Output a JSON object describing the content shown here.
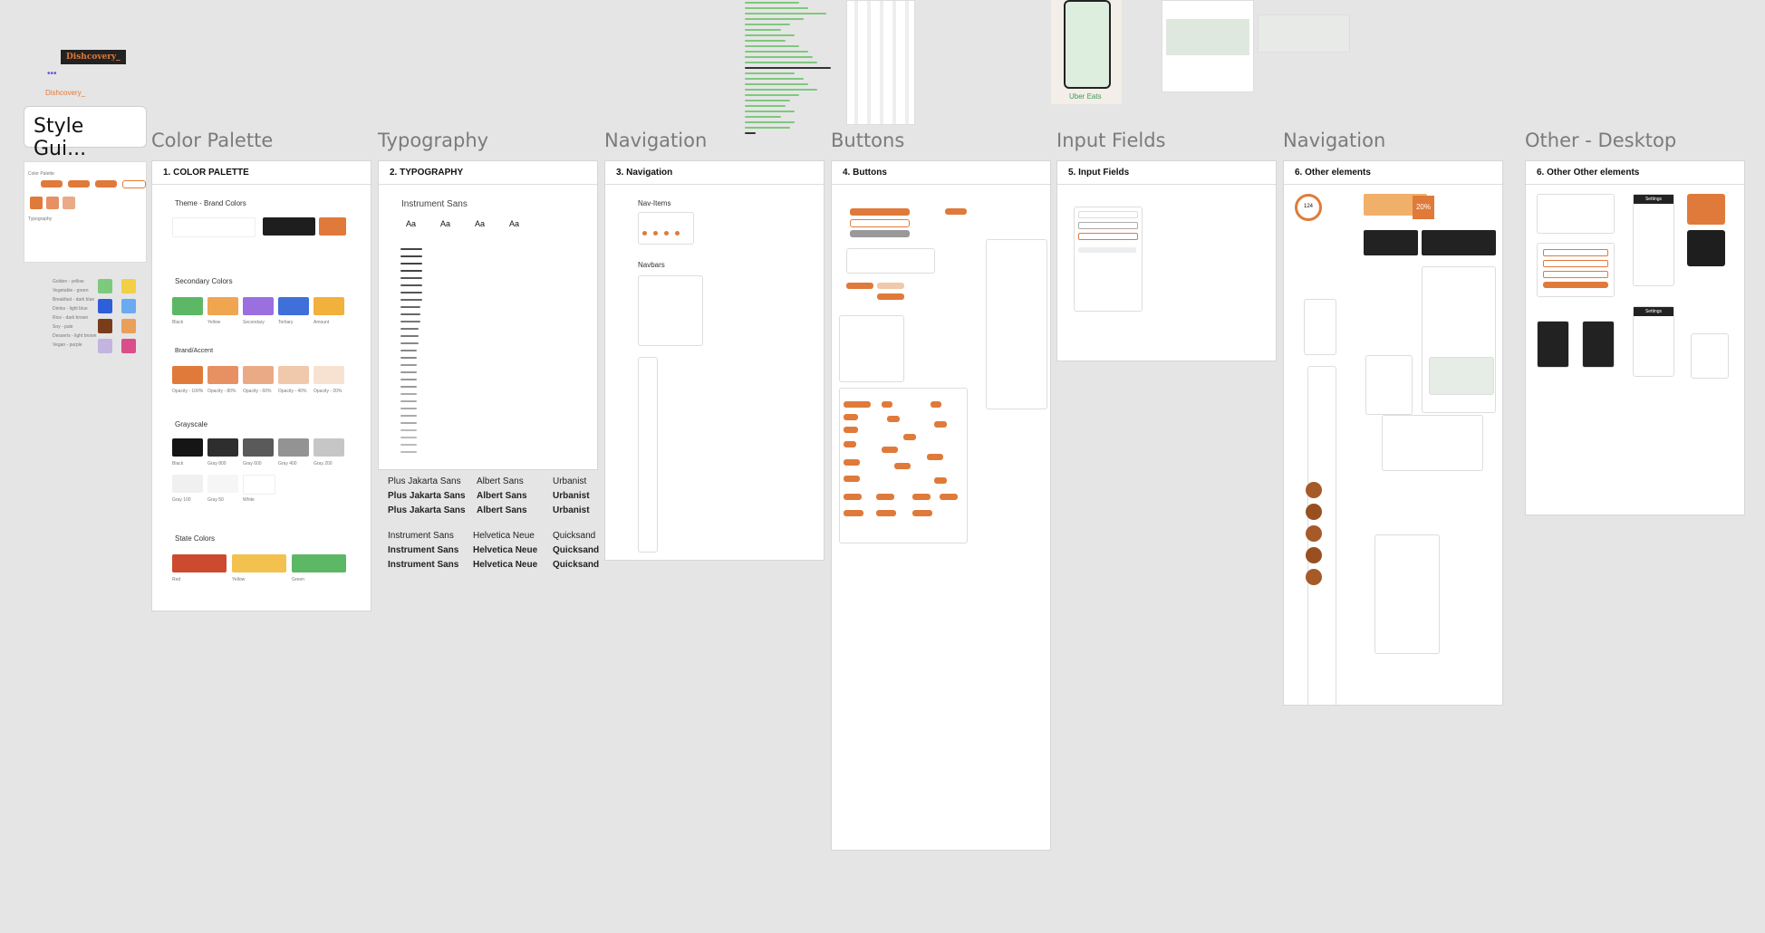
{
  "brand": {
    "logo_text": "Dishcovery_",
    "logo_text_small": "Dishcovery_",
    "dots": "•••"
  },
  "cover": {
    "title": "Style Gui..."
  },
  "thumb": {
    "title": "Color Palette",
    "sub": "Typography",
    "btn": "Place Order"
  },
  "side_colors": [
    "Golden - yellow",
    "Vegetable - green",
    "Breakfast - dark blue",
    "Drinks - light blue",
    "Rice - dark brown",
    "Soy - pale",
    "Desserts - light brown",
    "Vegan - purple"
  ],
  "frames": {
    "color_palette": {
      "label": "Color Palette",
      "header": "1. COLOR PALETTE"
    },
    "typography": {
      "label": "Typography",
      "header": "2. TYPOGRAPHY"
    },
    "navigation": {
      "label": "Navigation",
      "header": "3. Navigation"
    },
    "buttons": {
      "label": "Buttons",
      "header": "4. Buttons"
    },
    "input_fields": {
      "label": "Input Fields",
      "header": "5. Input Fields"
    },
    "other_elements": {
      "label": "Navigation",
      "header": "6. Other elements"
    },
    "other_desktop": {
      "label": "Other - Desktop",
      "header": "6. Other Other elements"
    }
  },
  "palette": {
    "theme_title": "Theme - Brand Colors",
    "secondary_title": "Secondary Colors",
    "brand_title": "Brand/Accent",
    "grayscale_title": "Grayscale",
    "state_title": "State Colors",
    "theme": [
      {
        "c": "#ffffff"
      },
      {
        "c": "#1e1e1e"
      },
      {
        "c": "#e07a3a"
      }
    ],
    "secondary": [
      {
        "c": "#5cb865",
        "n": "Black"
      },
      {
        "c": "#f0a550",
        "n": "Yellow"
      },
      {
        "c": "#9b6fe0",
        "n": "Secondary"
      },
      {
        "c": "#3f6fd8",
        "n": "Tertiary"
      },
      {
        "c": "#f2b03c",
        "n": "Amount"
      }
    ],
    "brand": [
      {
        "c": "#e07a3a",
        "n": "Opacity - 100%"
      },
      {
        "c": "#e69063",
        "n": "Opacity - 80%"
      },
      {
        "c": "#eaaa86",
        "n": "Opacity - 60%"
      },
      {
        "c": "#f0c8ab",
        "n": "Opacity - 40%"
      },
      {
        "c": "#f7e2d2",
        "n": "Opacity - 20%"
      }
    ],
    "grayscale": [
      {
        "c": "#151515",
        "n": "Black"
      },
      {
        "c": "#2e2e2e",
        "n": "Gray 800"
      },
      {
        "c": "#5a5a5a",
        "n": "Gray 600"
      },
      {
        "c": "#939393",
        "n": "Gray 400"
      },
      {
        "c": "#c6c6c6",
        "n": "Gray 200"
      },
      {
        "c": "#f0f0f0",
        "n": "Gray 100"
      },
      {
        "c": "#f6f6f6",
        "n": "Gray 50"
      },
      {
        "c": "#ffffff",
        "n": "White"
      }
    ],
    "state": [
      {
        "c": "#cc4b2e",
        "n": "Red"
      },
      {
        "c": "#f2c14e",
        "n": "Yellow"
      },
      {
        "c": "#5cb865",
        "n": "Green"
      }
    ]
  },
  "typography": {
    "family": "Instrument Sans",
    "samples": [
      "Aa",
      "Aa",
      "Aa",
      "Aa"
    ],
    "fonts": [
      [
        "Plus Jakarta Sans",
        "Albert Sans",
        "Urbanist"
      ],
      [
        "Plus Jakarta Sans",
        "Albert Sans",
        "Urbanist"
      ],
      [
        "Plus Jakarta Sans",
        "Albert Sans",
        "Urbanist"
      ],
      [
        "Instrument Sans",
        "Helvetica Neue",
        "Quicksand"
      ],
      [
        "Instrument Sans",
        "Helvetica Neue",
        "Quicksand"
      ],
      [
        "Instrument Sans",
        "Helvetica Neue",
        "Quicksand"
      ]
    ]
  },
  "nav": {
    "nav_items": "Nav-Items",
    "navbars": "Navbars"
  },
  "other": {
    "uber": "Uber Eats",
    "gauge": "124",
    "pct": "20%"
  },
  "desktop": {
    "settings": "Settings"
  }
}
